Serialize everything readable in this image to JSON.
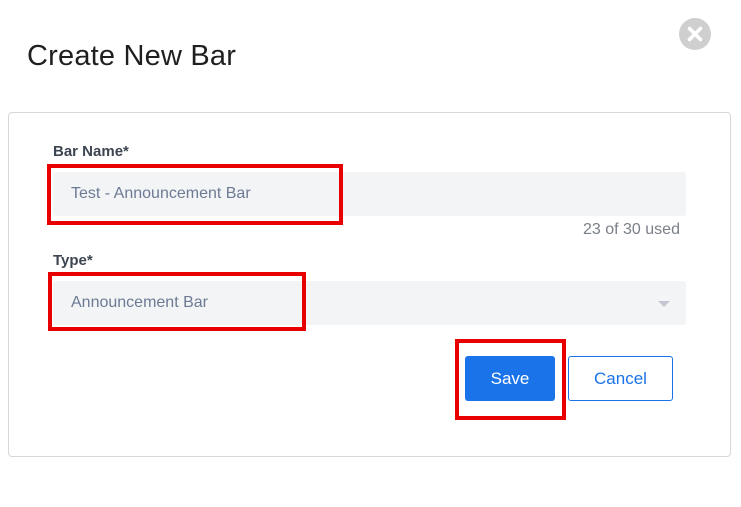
{
  "modal": {
    "title": "Create New Bar",
    "close_icon": "close-circle-icon"
  },
  "form": {
    "bar_name": {
      "label": "Bar Name*",
      "value": "Test - Announcement Bar",
      "counter": "23 of 30 used"
    },
    "type": {
      "label": "Type*",
      "selected": "Announcement Bar",
      "caret_icon": "chevron-down-icon"
    }
  },
  "actions": {
    "save_label": "Save",
    "cancel_label": "Cancel"
  },
  "colors": {
    "primary": "#1a73e8",
    "highlight": "#e80000",
    "input_bg": "#f3f4f6"
  }
}
